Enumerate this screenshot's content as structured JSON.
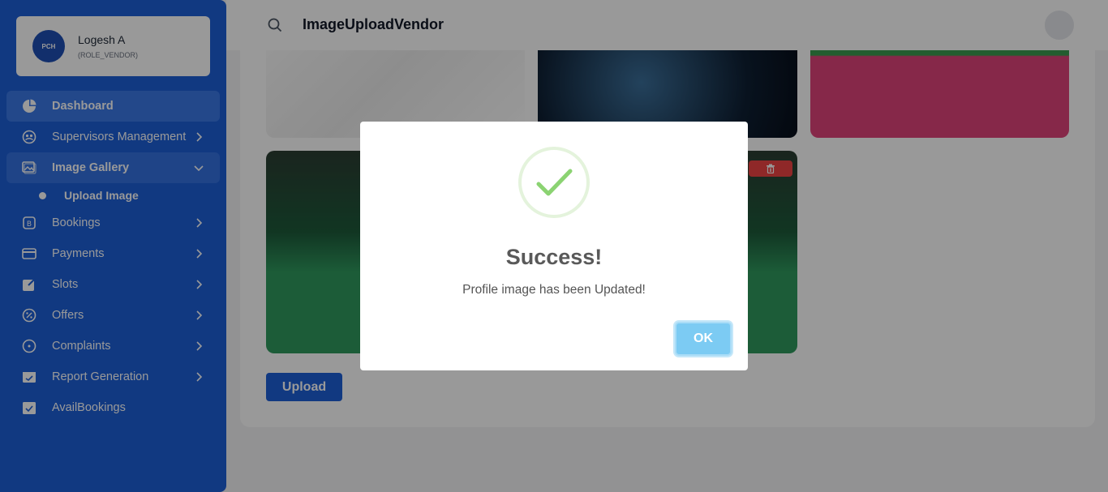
{
  "profile": {
    "name": "Logesh A",
    "role": "(ROLE_VENDOR)",
    "logo_text": "PCH"
  },
  "sidebar": {
    "items": [
      {
        "label": "Dashboard",
        "icon": "pie-chart-icon"
      },
      {
        "label": "Supervisors Management",
        "icon": "supervisor-icon"
      },
      {
        "label": "Image Gallery",
        "icon": "gallery-icon"
      },
      {
        "label": "Bookings",
        "icon": "booking-icon"
      },
      {
        "label": "Payments",
        "icon": "card-icon"
      },
      {
        "label": "Slots",
        "icon": "edit-icon"
      },
      {
        "label": "Offers",
        "icon": "discount-icon"
      },
      {
        "label": "Complaints",
        "icon": "complaint-icon"
      },
      {
        "label": "Report Generation",
        "icon": "report-icon"
      },
      {
        "label": "AvailBookings",
        "icon": "calendar-check-icon"
      }
    ],
    "sub_items": [
      {
        "label": "Upload Image"
      }
    ]
  },
  "header": {
    "title": "ImageUploadVendor"
  },
  "gallery": {
    "upload_label": "Upload"
  },
  "modal": {
    "title": "Success!",
    "message": "Profile image has been Updated!",
    "ok_label": "OK"
  }
}
